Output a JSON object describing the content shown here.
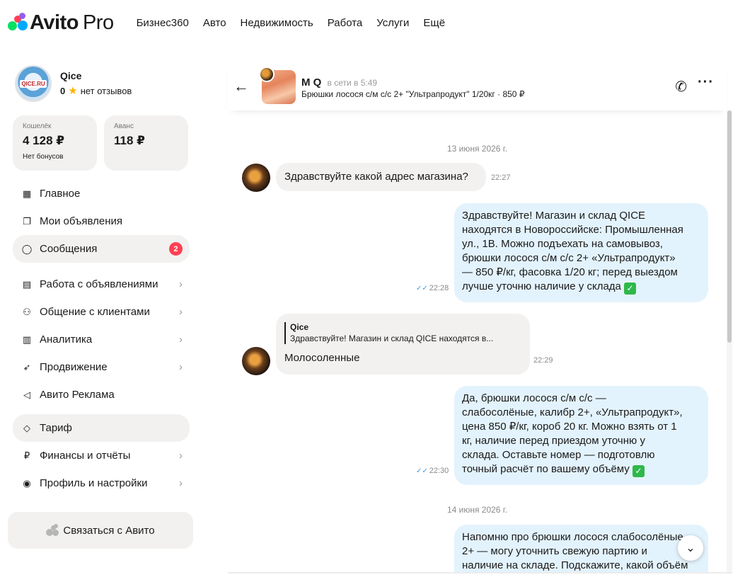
{
  "brand": {
    "name": "Avito",
    "suffix": "Pro"
  },
  "nav": [
    "Бизнес360",
    "Авто",
    "Недвижимость",
    "Работа",
    "Услуги",
    "Ещё"
  ],
  "profile": {
    "avatar_text": "QICE.RU",
    "name": "Qice",
    "rating": "0",
    "reviews": "нет отзывов"
  },
  "wallet": {
    "label": "Кошелёк",
    "value": "4 128 ₽",
    "sub": "Нет бонусов"
  },
  "advance": {
    "label": "Аванс",
    "value": "118 ₽"
  },
  "menu": [
    {
      "label": "Главное"
    },
    {
      "label": "Мои объявления"
    },
    {
      "label": "Сообщения",
      "badge": "2"
    },
    {
      "label": "Работа с объявлениями"
    },
    {
      "label": "Общение с клиентами"
    },
    {
      "label": "Аналитика"
    },
    {
      "label": "Продвижение"
    },
    {
      "label": "Авито Реклама"
    },
    {
      "label": "Тариф"
    },
    {
      "label": "Финансы и отчёты"
    },
    {
      "label": "Профиль и настройки"
    }
  ],
  "contact_button": "Связаться с Авито",
  "chat": {
    "name": "M Q",
    "status": "в сети в 5:49",
    "item": "Брюшки лосося с/м с/с 2+ \"Ультрапродукт\" 1/20кг · 850 ₽"
  },
  "dates": [
    "13 июня 2026 г.",
    "14 июня 2026 г."
  ],
  "messages": [
    {
      "text": "Здравствуйте какой адрес магазина?",
      "time": "22:27"
    },
    {
      "lines": [
        "Здравствуйте! Магазин и склад QICE",
        "находятся в Новороссийске: Промышленная",
        "ул., 1В. Можно подъехать на самовывоз,",
        "брюшки лосося с/м с/с 2+ «Ультрапродукт»",
        "— 850 ₽/кг, фасовка 1/20 кг; перед выездом",
        "лучше уточню наличие у склада"
      ],
      "time": "22:28"
    },
    {
      "quote_name": "Qice",
      "quote_text": "Здравствуйте! Магазин и склад QICE находятся в...",
      "text": "Молосоленные",
      "time": "22:29"
    },
    {
      "lines": [
        "Да, брюшки лосося с/м с/с —",
        "слабосолёные, калибр 2+, «Ультрапродукт»,",
        "цена 850 ₽/кг, короб 20 кг. Можно взять от 1",
        "кг, наличие перед приездом уточню у",
        "склада. Оставьте номер — подготовлю",
        "точный расчёт по вашему объёму"
      ],
      "time": "22:30"
    },
    {
      "lines": [
        "Напомню про брюшки лосося слабосолёные",
        "2+ — могу уточнить свежую партию и",
        "наличие на складе. Подскажите, какой объём"
      ]
    }
  ],
  "colors": {
    "accent_blue": "#3a9be8",
    "badge_red": "#ff4053",
    "outgoing": "#e3f3fd",
    "incoming": "#f2f1f0",
    "check_green": "#2fb84b"
  },
  "icons": {
    "logo": "avito-dots-icon",
    "back": "arrow-left-icon",
    "phone": "phone-icon",
    "more": "more-dots-icon",
    "scroll": "chevron-down-icon"
  }
}
